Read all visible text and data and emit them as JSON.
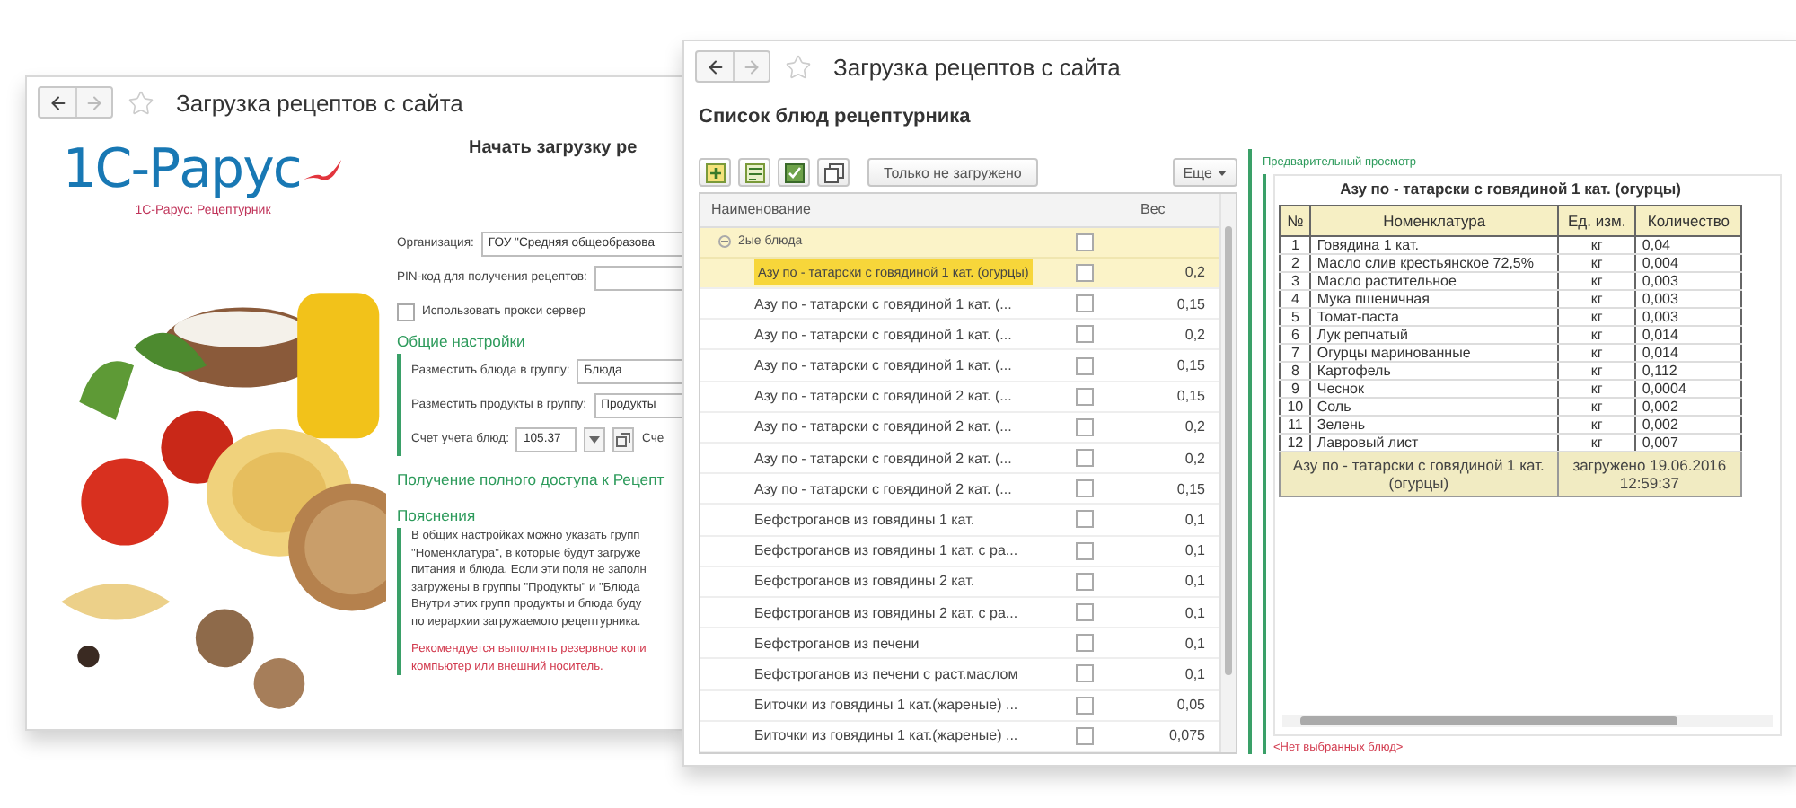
{
  "back_window": {
    "title": "Загрузка рецептов с сайта",
    "logo": {
      "name": "1С-Рарус",
      "caption": "1С-Рарус: Рецептурник"
    },
    "heading": "Начать загрузку ре",
    "fields": [
      {
        "label": "Организация:",
        "value": "ГОУ \"Средняя общеобразова"
      },
      {
        "label": "PIN-код для получения рецептов:"
      }
    ],
    "proxy": {
      "label": "Использовать прокси сервер",
      "checked": false
    },
    "general": {
      "title": "Общие настройки",
      "fields": [
        {
          "kind": "plain",
          "label": "Разместить блюда в группу:",
          "value": "Блюда"
        },
        {
          "kind": "plain",
          "label": "Разместить продукты в группу:",
          "value": "Продукты"
        },
        {
          "kind": "account",
          "label": "Счет учета блюд:",
          "value": "105.37",
          "trailing": "Сче"
        }
      ]
    },
    "access_link": "Получение полного доступа к Рецепт",
    "notes": {
      "title": "Пояснения",
      "lines": [
        "В общих настройках можно указать групп",
        "\"Номенклатура\", в которые будут загруже",
        "питания и блюда. Если эти поля не заполн",
        "загружены в группы \"Продукты\" и \"Блюда",
        "Внутри этих групп продукты и блюда буду",
        "по иерархии загружаемого рецептурника."
      ],
      "warning_lines": [
        "Рекомендуется выполнять резервное копи",
        "компьютер или внешний носитель."
      ]
    }
  },
  "front_window": {
    "title": "Загрузка рецептов с сайта",
    "heading": "Список блюд рецептурника",
    "toolbar": {
      "filter_button": "Только не загружено",
      "more_button": "Еще"
    },
    "list": {
      "columns": [
        "Наименование",
        "Вес"
      ],
      "group": {
        "label": "2ые блюда",
        "expanded": true,
        "checked": false
      },
      "rows": [
        {
          "name": "Азу по - татарски с говядиной 1 кат. (огурцы)",
          "weight": "0,2",
          "checked": false,
          "selected": true
        },
        {
          "name": "Азу по - татарски с говядиной 1 кат. (...",
          "weight": "0,15",
          "checked": false,
          "selected": false
        },
        {
          "name": "Азу по - татарски с говядиной 1 кат. (...",
          "weight": "0,2",
          "checked": false,
          "selected": false
        },
        {
          "name": "Азу по - татарски с говядиной 1 кат. (...",
          "weight": "0,15",
          "checked": false,
          "selected": false
        },
        {
          "name": "Азу по - татарски с говядиной 2 кат. (...",
          "weight": "0,15",
          "checked": false,
          "selected": false
        },
        {
          "name": "Азу по - татарски с говядиной 2 кат. (...",
          "weight": "0,2",
          "checked": false,
          "selected": false
        },
        {
          "name": "Азу по - татарски с говядиной 2 кат. (...",
          "weight": "0,2",
          "checked": false,
          "selected": false
        },
        {
          "name": "Азу по - татарски с говядиной 2 кат. (...",
          "weight": "0,15",
          "checked": false,
          "selected": false
        },
        {
          "name": "Бефстроганов из говядины 1 кат.",
          "weight": "0,1",
          "checked": false,
          "selected": false
        },
        {
          "name": "Бефстроганов из говядины 1 кат. с ра...",
          "weight": "0,1",
          "checked": false,
          "selected": false
        },
        {
          "name": "Бефстроганов из говядины 2 кат.",
          "weight": "0,1",
          "checked": false,
          "selected": false
        },
        {
          "name": "Бефстроганов из говядины 2 кат. с ра...",
          "weight": "0,1",
          "checked": false,
          "selected": false
        },
        {
          "name": "Бефстроганов из печени",
          "weight": "0,1",
          "checked": false,
          "selected": false
        },
        {
          "name": "Бефстроганов из печени с раст.маслом",
          "weight": "0,1",
          "checked": false,
          "selected": false
        },
        {
          "name": "Биточки из говядины 1 кат.(жареные) ...",
          "weight": "0,05",
          "checked": false,
          "selected": false
        },
        {
          "name": "Биточки из говядины 1 кат.(жареные) ...",
          "weight": "0,075",
          "checked": false,
          "selected": false
        }
      ]
    },
    "preview": {
      "label": "Предварительный просмотр",
      "title": "Азу по - татарски с говядиной 1 кат. (огурцы)",
      "columns": [
        "№",
        "Номенклатура",
        "Ед. изм.",
        "Количество"
      ],
      "rows": [
        [
          "1",
          "Говядина 1 кат.",
          "кг",
          "0,04"
        ],
        [
          "2",
          "Масло слив крестьянское 72,5%",
          "кг",
          "0,004"
        ],
        [
          "3",
          "Масло растительное",
          "кг",
          "0,003"
        ],
        [
          "4",
          "Мука пшеничная",
          "кг",
          "0,003"
        ],
        [
          "5",
          "Томат-паста",
          "кг",
          "0,003"
        ],
        [
          "6",
          "Лук репчатый",
          "кг",
          "0,014"
        ],
        [
          "7",
          "Огурцы маринованные",
          "кг",
          "0,014"
        ],
        [
          "8",
          "Картофель",
          "кг",
          "0,112"
        ],
        [
          "9",
          "Чеснок",
          "кг",
          "0,0004"
        ],
        [
          "10",
          "Соль",
          "кг",
          "0,002"
        ],
        [
          "11",
          "Зелень",
          "кг",
          "0,002"
        ],
        [
          "12",
          "Лавровый лист",
          "кг",
          "0,007"
        ]
      ],
      "footer": {
        "dish": "Азу по - татарски с говядиной 1 кат. (огурцы)",
        "status": "загружено 19.06.2016 12:59:37"
      },
      "empty_note": "<Нет выбранных блюд>"
    }
  }
}
